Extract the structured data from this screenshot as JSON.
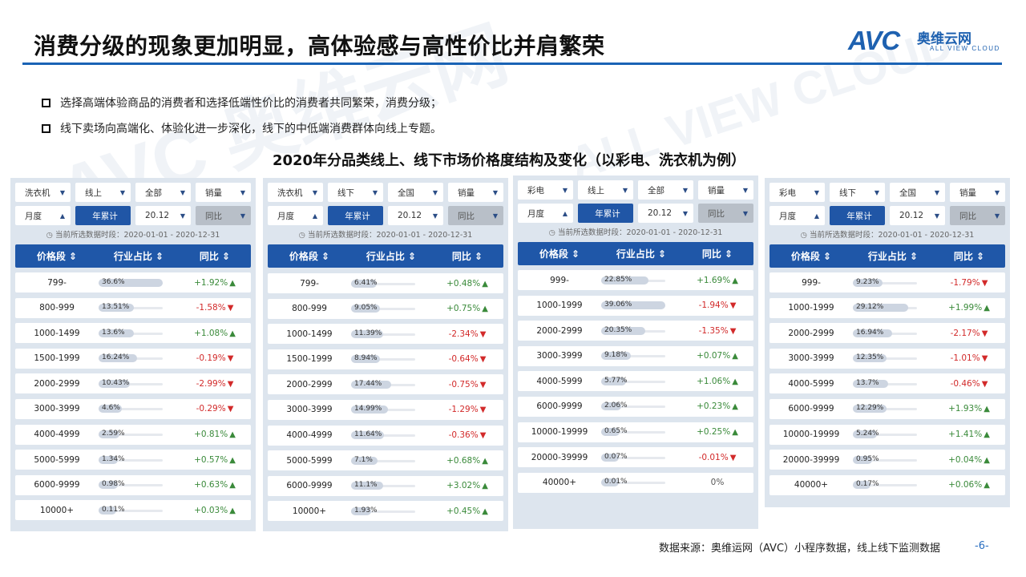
{
  "title": "消费分级的现象更加明显，高体验感与高性价比并肩繁荣",
  "logo": {
    "mark": "AVC",
    "cn": "奥维云网",
    "en": "ALL VIEW CLOUD"
  },
  "watermark": "AVC 奥维云网 ALL VIEW CLOUD",
  "bullets": [
    "选择高端体验商品的消费者和选择低端性价比的消费者共同繁荣，消费分级；",
    "线下卖场向高端化、体验化进一步深化，线下的中低端消费群体向线上专题。"
  ],
  "subtitle": "2020年分品类线上、线下市场价格度结构及变化（以彩电、洗衣机为例）",
  "headers": {
    "price": "价格段 ⇕",
    "share": "行业占比 ⇕",
    "yoy": "同比 ⇕"
  },
  "period_label": "当前所选数据时段：2020-01-01 - 2020-12-31",
  "panels": [
    {
      "filters": {
        "category": "洗衣机",
        "channel": "线上",
        "region": "全部",
        "metric": "销量",
        "granularity": "月度",
        "cumulative": "年累计",
        "date": "20.12",
        "compare": "同比"
      },
      "rows": [
        {
          "price": "799-",
          "share": "36.6%",
          "share_value": 36.6,
          "yoy": "+1.92%",
          "dir": "up"
        },
        {
          "price": "800-999",
          "share": "13.51%",
          "share_value": 13.51,
          "yoy": "-1.58%",
          "dir": "down"
        },
        {
          "price": "1000-1499",
          "share": "13.6%",
          "share_value": 13.6,
          "yoy": "+1.08%",
          "dir": "up"
        },
        {
          "price": "1500-1999",
          "share": "16.24%",
          "share_value": 16.24,
          "yoy": "-0.19%",
          "dir": "down"
        },
        {
          "price": "2000-2999",
          "share": "10.43%",
          "share_value": 10.43,
          "yoy": "-2.99%",
          "dir": "down"
        },
        {
          "price": "3000-3999",
          "share": "4.6%",
          "share_value": 4.6,
          "yoy": "-0.29%",
          "dir": "down"
        },
        {
          "price": "4000-4999",
          "share": "2.59%",
          "share_value": 2.59,
          "yoy": "+0.81%",
          "dir": "up"
        },
        {
          "price": "5000-5999",
          "share": "1.34%",
          "share_value": 1.34,
          "yoy": "+0.57%",
          "dir": "up"
        },
        {
          "price": "6000-9999",
          "share": "0.98%",
          "share_value": 0.98,
          "yoy": "+0.63%",
          "dir": "up"
        },
        {
          "price": "10000+",
          "share": "0.11%",
          "share_value": 0.11,
          "yoy": "+0.03%",
          "dir": "up"
        }
      ]
    },
    {
      "filters": {
        "category": "洗衣机",
        "channel": "线下",
        "region": "全国",
        "metric": "销量",
        "granularity": "月度",
        "cumulative": "年累计",
        "date": "20.12",
        "compare": "同比"
      },
      "rows": [
        {
          "price": "799-",
          "share": "6.41%",
          "share_value": 6.41,
          "yoy": "+0.48%",
          "dir": "up"
        },
        {
          "price": "800-999",
          "share": "9.05%",
          "share_value": 9.05,
          "yoy": "+0.75%",
          "dir": "up"
        },
        {
          "price": "1000-1499",
          "share": "11.39%",
          "share_value": 11.39,
          "yoy": "-2.34%",
          "dir": "down"
        },
        {
          "price": "1500-1999",
          "share": "8.94%",
          "share_value": 8.94,
          "yoy": "-0.64%",
          "dir": "down"
        },
        {
          "price": "2000-2999",
          "share": "17.44%",
          "share_value": 17.44,
          "yoy": "-0.75%",
          "dir": "down"
        },
        {
          "price": "3000-3999",
          "share": "14.99%",
          "share_value": 14.99,
          "yoy": "-1.29%",
          "dir": "down"
        },
        {
          "price": "4000-4999",
          "share": "11.64%",
          "share_value": 11.64,
          "yoy": "-0.36%",
          "dir": "down"
        },
        {
          "price": "5000-5999",
          "share": "7.1%",
          "share_value": 7.1,
          "yoy": "+0.68%",
          "dir": "up"
        },
        {
          "price": "6000-9999",
          "share": "11.1%",
          "share_value": 11.1,
          "yoy": "+3.02%",
          "dir": "up"
        },
        {
          "price": "10000+",
          "share": "1.93%",
          "share_value": 1.93,
          "yoy": "+0.45%",
          "dir": "up"
        }
      ]
    },
    {
      "filters": {
        "category": "彩电",
        "channel": "线上",
        "region": "全部",
        "metric": "销量",
        "granularity": "月度",
        "cumulative": "年累计",
        "date": "20.12",
        "compare": "同比"
      },
      "rows": [
        {
          "price": "999-",
          "share": "22.85%",
          "share_value": 22.85,
          "yoy": "+1.69%",
          "dir": "up"
        },
        {
          "price": "1000-1999",
          "share": "39.06%",
          "share_value": 39.06,
          "yoy": "-1.94%",
          "dir": "down"
        },
        {
          "price": "2000-2999",
          "share": "20.35%",
          "share_value": 20.35,
          "yoy": "-1.35%",
          "dir": "down"
        },
        {
          "price": "3000-3999",
          "share": "9.18%",
          "share_value": 9.18,
          "yoy": "+0.07%",
          "dir": "up"
        },
        {
          "price": "4000-5999",
          "share": "5.77%",
          "share_value": 5.77,
          "yoy": "+1.06%",
          "dir": "up"
        },
        {
          "price": "6000-9999",
          "share": "2.06%",
          "share_value": 2.06,
          "yoy": "+0.23%",
          "dir": "up"
        },
        {
          "price": "10000-19999",
          "share": "0.65%",
          "share_value": 0.65,
          "yoy": "+0.25%",
          "dir": "up"
        },
        {
          "price": "20000-39999",
          "share": "0.07%",
          "share_value": 0.07,
          "yoy": "-0.01%",
          "dir": "down"
        },
        {
          "price": "40000+",
          "share": "0.01%",
          "share_value": 0.01,
          "yoy": "0%",
          "dir": "flat"
        }
      ]
    },
    {
      "filters": {
        "category": "彩电",
        "channel": "线下",
        "region": "全国",
        "metric": "销量",
        "granularity": "月度",
        "cumulative": "年累计",
        "date": "20.12",
        "compare": "同比"
      },
      "rows": [
        {
          "price": "999-",
          "share": "9.23%",
          "share_value": 9.23,
          "yoy": "-1.79%",
          "dir": "down"
        },
        {
          "price": "1000-1999",
          "share": "29.12%",
          "share_value": 29.12,
          "yoy": "+1.99%",
          "dir": "up"
        },
        {
          "price": "2000-2999",
          "share": "16.94%",
          "share_value": 16.94,
          "yoy": "-2.17%",
          "dir": "down"
        },
        {
          "price": "3000-3999",
          "share": "12.35%",
          "share_value": 12.35,
          "yoy": "-1.01%",
          "dir": "down"
        },
        {
          "price": "4000-5999",
          "share": "13.7%",
          "share_value": 13.7,
          "yoy": "-0.46%",
          "dir": "down"
        },
        {
          "price": "6000-9999",
          "share": "12.29%",
          "share_value": 12.29,
          "yoy": "+1.93%",
          "dir": "up"
        },
        {
          "price": "10000-19999",
          "share": "5.24%",
          "share_value": 5.24,
          "yoy": "+1.41%",
          "dir": "up"
        },
        {
          "price": "20000-39999",
          "share": "0.95%",
          "share_value": 0.95,
          "yoy": "+0.04%",
          "dir": "up"
        },
        {
          "price": "40000+",
          "share": "0.17%",
          "share_value": 0.17,
          "yoy": "+0.06%",
          "dir": "up"
        }
      ]
    }
  ],
  "source": "数据来源：奥维运网（AVC）小程序数据，线上线下监测数据",
  "page_number": "-6-",
  "colors": {
    "brand": "#1e61b0",
    "header": "#1f57a8",
    "up": "#3a8a3a",
    "down": "#d22a2a",
    "panel_bg": "#dde5ee"
  }
}
